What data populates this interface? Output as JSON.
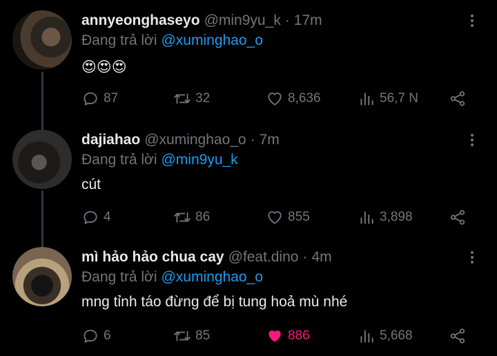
{
  "tweets": [
    {
      "display_name": "annyeonghaseyo",
      "handle": "@min9yu_k",
      "dot": "·",
      "time": "17m",
      "reply_prefix": "Đang trả lời",
      "reply_to": "@xuminghao_o",
      "text": "😍😍😍",
      "replies": "87",
      "retweets": "32",
      "likes": "8,636",
      "views": "56,7 N",
      "liked": false
    },
    {
      "display_name": "dajiahao",
      "handle": "@xuminghao_o",
      "dot": "·",
      "time": "7m",
      "reply_prefix": "Đang trả lời",
      "reply_to": "@min9yu_k",
      "text": "cút",
      "replies": "4",
      "retweets": "86",
      "likes": "855",
      "views": "3,898",
      "liked": false
    },
    {
      "display_name": "mì hảo hảo chua cay",
      "handle": "@feat.dino",
      "dot": "·",
      "time": "4m",
      "reply_prefix": "Đang trả lời",
      "reply_to": "@xuminghao_o",
      "text": "mng tỉnh táo đừng để bị tung hoả mù nhé",
      "replies": "6",
      "retweets": "85",
      "likes": "886",
      "views": "5,668",
      "liked": true
    }
  ],
  "colors": {
    "background": "#000000",
    "text": "#e7e9ea",
    "muted": "#71767b",
    "mention": "#1d9bf0",
    "like_active": "#f91880"
  },
  "icons": [
    "reply-icon",
    "retweet-icon",
    "heart-icon",
    "views-icon",
    "share-icon",
    "more-icon"
  ]
}
